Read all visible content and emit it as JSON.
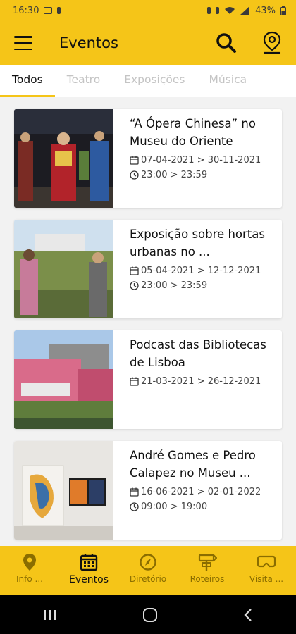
{
  "status_bar": {
    "time": "16:30",
    "battery": "43%"
  },
  "app_bar": {
    "title": "Eventos",
    "icons": [
      "menu-icon",
      "search-icon",
      "map-pin-icon"
    ]
  },
  "tabs": [
    {
      "label": "Todos"
    },
    {
      "label": "Teatro"
    },
    {
      "label": "Exposições"
    },
    {
      "label": "Música"
    }
  ],
  "events": [
    {
      "title": "“A Ópera Chinesa” no Museu do Oriente",
      "dates": "07-04-2021 > 30-11-2021",
      "hours": "23:00 > 23:59"
    },
    {
      "title": "Exposição sobre hortas urbanas no ...",
      "dates": "05-04-2021 > 12-12-2021",
      "hours": "23:00 > 23:59"
    },
    {
      "title": "Podcast das Bibliotecas de Lisboa",
      "dates": "21-03-2021 > 26-12-2021"
    },
    {
      "title": "André Gomes e Pedro Calapez no Museu ...",
      "dates": "16-06-2021 > 02-01-2022",
      "hours": "09:00 > 19:00"
    }
  ],
  "bottom_nav": [
    {
      "label": "Info ...",
      "icon": "location-icon"
    },
    {
      "label": "Eventos",
      "icon": "calendar-icon"
    },
    {
      "label": "Diretório",
      "icon": "compass-icon"
    },
    {
      "label": "Roteiros",
      "icon": "signpost-icon"
    },
    {
      "label": "Visita ...",
      "icon": "vr-headset-icon"
    }
  ],
  "colors": {
    "accent": "#f5c518",
    "text": "#111111",
    "inactive_tab": "#c4c4c4"
  }
}
